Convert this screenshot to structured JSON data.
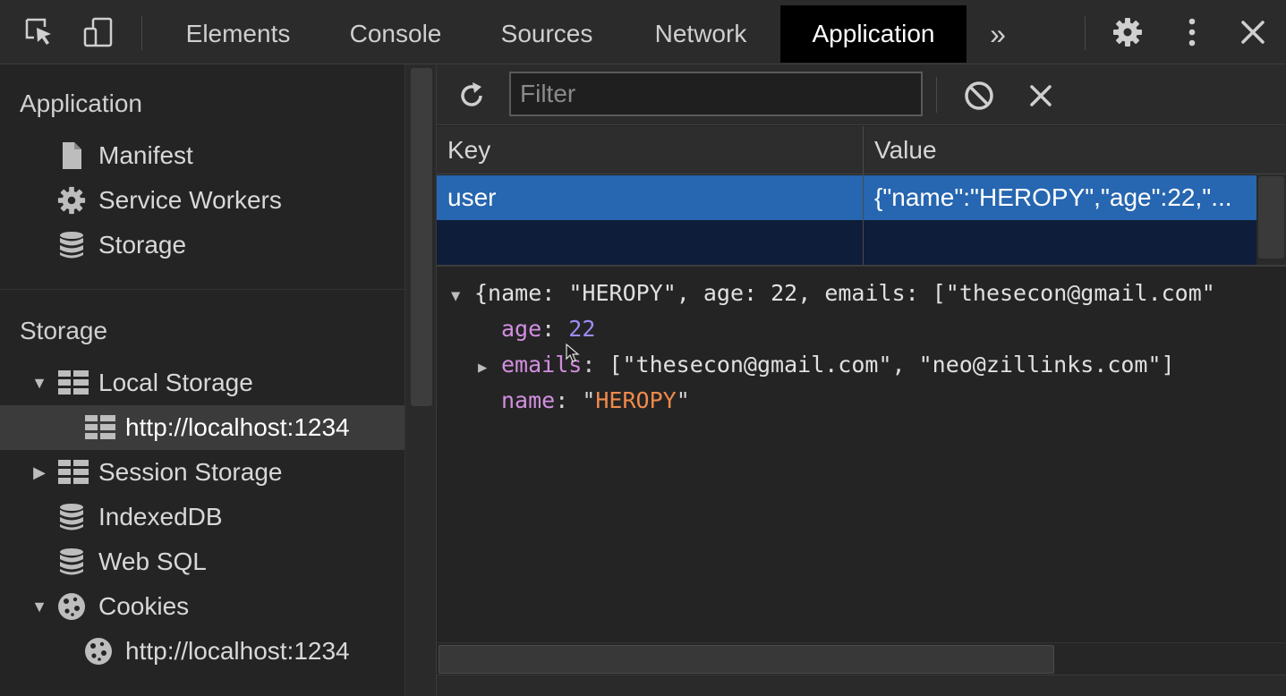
{
  "tabs": {
    "elements": "Elements",
    "console": "Console",
    "sources": "Sources",
    "network": "Network",
    "application": "Application",
    "more": "»"
  },
  "sidebar": {
    "application_header": "Application",
    "application_items": [
      {
        "label": "Manifest",
        "icon": "file-icon"
      },
      {
        "label": "Service Workers",
        "icon": "gear-icon"
      },
      {
        "label": "Storage",
        "icon": "database-icon"
      }
    ],
    "storage_header": "Storage",
    "storage_items": [
      {
        "label": "Local Storage",
        "icon": "grid-icon",
        "expanded": true
      },
      {
        "label": "http://localhost:1234",
        "icon": "grid-icon",
        "selected": true
      },
      {
        "label": "Session Storage",
        "icon": "grid-icon",
        "expanded": false
      },
      {
        "label": "IndexedDB",
        "icon": "database-icon"
      },
      {
        "label": "Web SQL",
        "icon": "database-icon"
      },
      {
        "label": "Cookies",
        "icon": "cookie-icon",
        "expanded": true
      },
      {
        "label": "http://localhost:1234",
        "icon": "cookie-icon"
      }
    ]
  },
  "toolbar": {
    "filter_placeholder": "Filter"
  },
  "table": {
    "headers": {
      "key": "Key",
      "value": "Value"
    },
    "rows": [
      {
        "key": "user",
        "value": "{\"name\":\"HEROPY\",\"age\":22,\"..."
      }
    ]
  },
  "preview": {
    "summary": "{name: \"HEROPY\", age: 22, emails: [\"thesecon@gmail.com\"",
    "age_key": "age",
    "age_value": "22",
    "emails_key": "emails",
    "emails_value": "[\"thesecon@gmail.com\", \"neo@zillinks.com\"]",
    "name_key": "name",
    "name_value": "HEROPY"
  },
  "colors": {
    "selected_row": "#2766b0",
    "active_tab": "#000000",
    "json_key": "#d28fe0",
    "json_number": "#9c8cf4",
    "json_string": "#f08a4b"
  }
}
